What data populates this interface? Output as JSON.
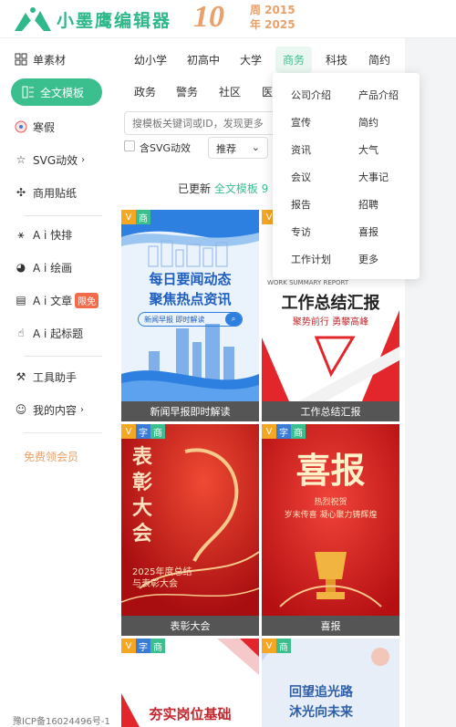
{
  "brand": {
    "name": "小墨鹰编辑器",
    "ten": "10",
    "anniv_line1": "周 2015",
    "anniv_line2": "年 2025"
  },
  "sidebar": {
    "items": [
      {
        "label": "单素材",
        "icon": "grid-icon"
      },
      {
        "label": "全文模板",
        "icon": "template-icon"
      },
      {
        "label": "寒假",
        "icon": "holiday-icon"
      },
      {
        "label": "SVG动效",
        "icon": "star-icon"
      },
      {
        "label": "商用贴纸",
        "icon": "puzzle-icon"
      },
      {
        "label": "A i 快排",
        "icon": "ai-icon"
      },
      {
        "label": "A i 绘画",
        "icon": "palette-icon"
      },
      {
        "label": "A i 文章",
        "icon": "doc-icon",
        "badge": "限免"
      },
      {
        "label": "A i 起标题",
        "icon": "hand-icon"
      },
      {
        "label": "工具助手",
        "icon": "tool-icon"
      },
      {
        "label": "我的内容",
        "icon": "user-icon"
      }
    ],
    "vip": "免费领会员",
    "icp": "豫ICP备16024496号-1"
  },
  "categories": {
    "row1": [
      "幼小学",
      "初高中",
      "大学",
      "商务",
      "科技",
      "简约"
    ],
    "row2": [
      "政务",
      "警务",
      "社区",
      "医"
    ]
  },
  "search": {
    "placeholder": "搜模板关键词或ID，发现更多"
  },
  "filter": {
    "svg_label": "含SVG动效",
    "sort_value": "推荐"
  },
  "updated": {
    "prefix": "已更新",
    "highlight": "全文模板 9"
  },
  "dropdown": {
    "items": [
      [
        "公司介绍",
        "产品介绍"
      ],
      [
        "宣传",
        "简约"
      ],
      [
        "资讯",
        "大气"
      ],
      [
        "会议",
        "大事记"
      ],
      [
        "报告",
        "招聘"
      ],
      [
        "专访",
        "喜报"
      ],
      [
        "工作计划",
        "更多"
      ]
    ]
  },
  "cards": [
    {
      "caption": "新闻早报即时解读",
      "line1": "每日要闻动态",
      "line2": "聚焦热点资讯",
      "pill": "新闻早报 即时解读",
      "tags": [
        "V",
        "商"
      ]
    },
    {
      "caption": "工作总结汇报",
      "eyebrow": "WORK SUMMARY REPORT",
      "title": "工作总结汇报",
      "sub": "聚势前行 勇攀高峰",
      "tags": [
        "V",
        "商"
      ]
    },
    {
      "caption": "表彰大会",
      "big": "表彰大会",
      "sub1": "2025年度总结",
      "sub2": "与表彰大会",
      "tags": [
        "V",
        "字",
        "商"
      ]
    },
    {
      "caption": "喜报",
      "big": "喜报",
      "sub1": "热烈祝贺",
      "sub2": "岁末传喜 凝心聚力铸辉煌",
      "tags": [
        "V",
        "字",
        "商"
      ]
    },
    {
      "title": "夯实岗位基础",
      "tags": [
        "V",
        "字",
        "商"
      ]
    },
    {
      "line1": "回望追光路",
      "line2": "沐光向未来",
      "tags": [
        "V",
        "商"
      ]
    }
  ],
  "colors": {
    "accent": "#3cbf8f",
    "orange": "#e9a06a",
    "badge": "#f26b4b"
  }
}
